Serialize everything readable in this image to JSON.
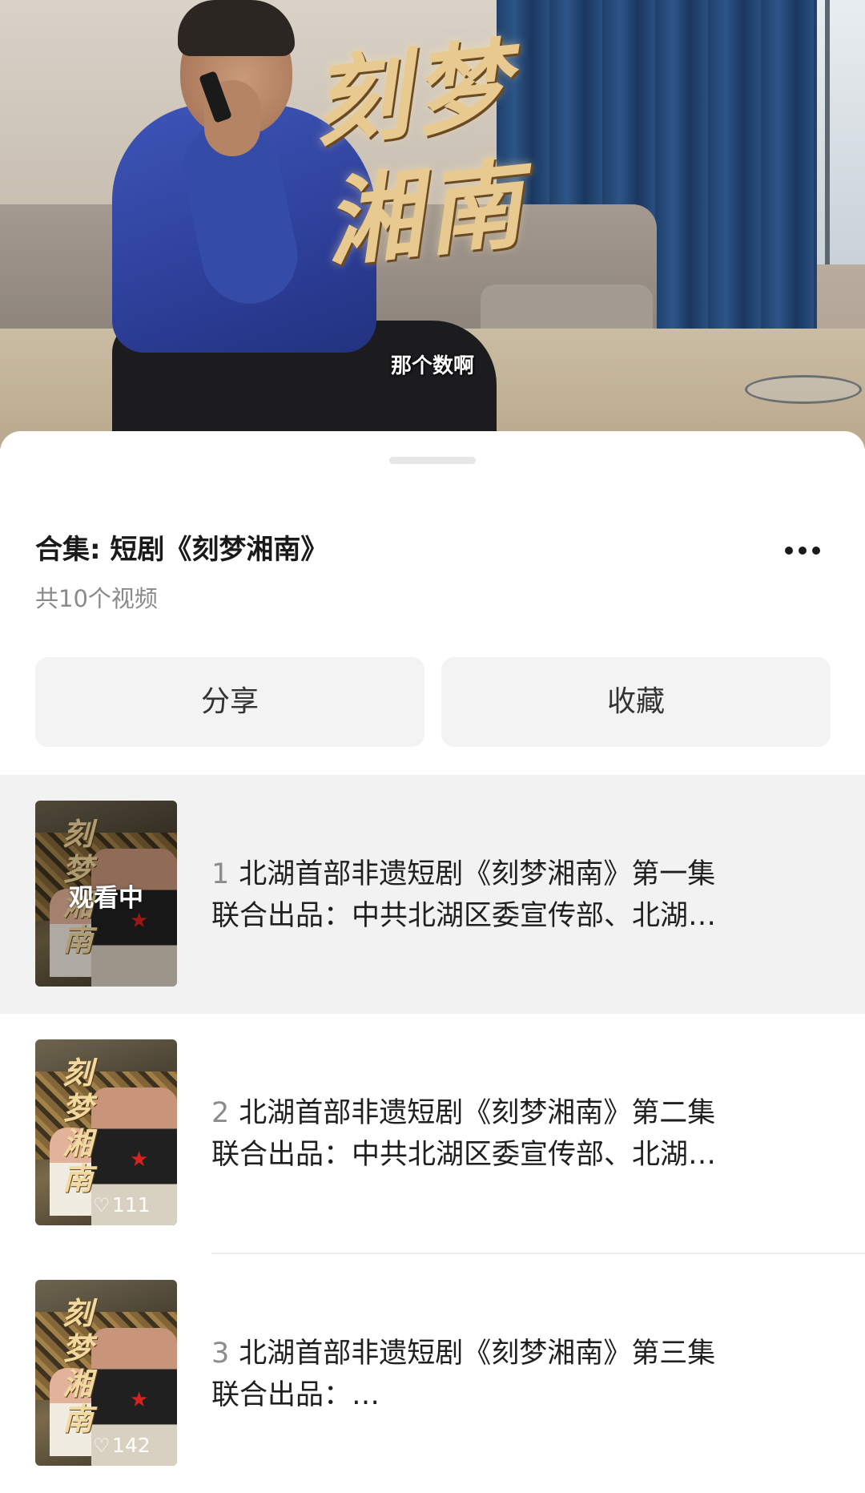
{
  "video": {
    "title_art": [
      "刻梦",
      "湘南"
    ],
    "subtitle": "那个数啊"
  },
  "collection": {
    "title": "合集: 短剧《刻梦湘南》",
    "count": "共10个视频",
    "more_icon": "more-dots-icon"
  },
  "actions": {
    "share": "分享",
    "favorite": "收藏"
  },
  "episodes": [
    {
      "number": "1",
      "title": "北湖首部非遗短剧《刻梦湘南》第一集",
      "subtitle": "联合出品：中共北湖区委宣传部、北湖…",
      "badge": "观看中",
      "likes": "",
      "active": true,
      "thumb_art": "刻梦湘南"
    },
    {
      "number": "2",
      "title": "北湖首部非遗短剧《刻梦湘南》第二集",
      "subtitle": "联合出品：中共北湖区委宣传部、北湖…",
      "badge": "",
      "likes": "111",
      "active": false,
      "thumb_art": "刻梦湘南"
    },
    {
      "number": "3",
      "title": "北湖首部非遗短剧《刻梦湘南》第三集",
      "subtitle": "联合出品：…",
      "badge": "",
      "likes": "142",
      "active": false,
      "thumb_art": "刻梦湘南"
    }
  ],
  "colors": {
    "active_row_bg": "#f2f2f2",
    "button_bg": "#f3f3f3",
    "title_art": "#e8c98f"
  }
}
